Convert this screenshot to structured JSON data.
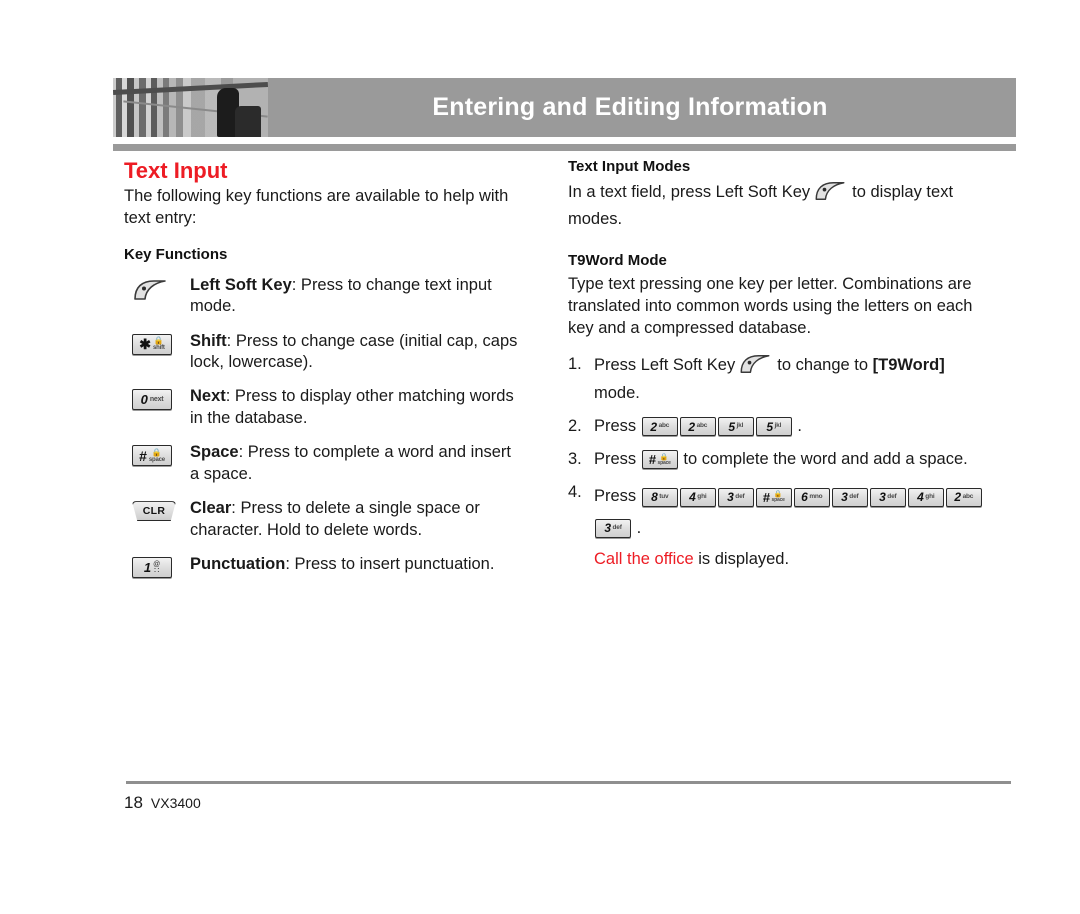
{
  "header": {
    "title": "Entering and Editing Information",
    "photo_alt": "grayscale-architecture-photo"
  },
  "left_column": {
    "section_title": "Text Input",
    "intro": "The following key functions are available to help with text entry:",
    "subheading": "Key Functions",
    "key_functions": [
      {
        "icon": "left-soft-key",
        "key_label": "",
        "key_sub": "",
        "term": "Left Soft Key",
        "description": ": Press to change text input mode."
      },
      {
        "icon": "star-shift-key",
        "key_label": "✳",
        "key_sub": "shift",
        "term": "Shift",
        "description": ": Press to change case (initial cap, caps lock, lowercase)."
      },
      {
        "icon": "zero-next-key",
        "key_label": "0",
        "key_sub": "next",
        "term": "Next",
        "description": ": Press to display other matching words in the database."
      },
      {
        "icon": "pound-space-key",
        "key_label": "#",
        "key_sub": "space",
        "term": "Space",
        "description": ": Press to complete a word and insert a space."
      },
      {
        "icon": "clear-key",
        "key_label": "CLR",
        "key_sub": "",
        "term": "Clear",
        "description": ": Press to delete a single space or character. Hold to delete words."
      },
      {
        "icon": "one-punctuation-key",
        "key_label": "1",
        "key_sub": "@",
        "term": "Punctuation",
        "description": ": Press to insert punctuation."
      }
    ]
  },
  "right_column": {
    "text_input_modes": {
      "heading": "Text Input Modes",
      "text_before_icon": "In a text field, press Left Soft Key",
      "text_after_icon": "to display text modes."
    },
    "t9word_mode": {
      "heading": "T9Word Mode",
      "paragraph": "Type text pressing one key per letter. Combinations are translated into common words using the letters on each key and a compressed database."
    },
    "steps": [
      {
        "num": "1.",
        "text_before_icon": "Press Left Soft Key",
        "text_after_icon": "to change to ",
        "bold_tail": "[T9Word]",
        "tail": " mode.",
        "keys": []
      },
      {
        "num": "2.",
        "text_before_keys": "Press",
        "keys": [
          {
            "big": "2",
            "sub": "abc"
          },
          {
            "big": "2",
            "sub": "abc"
          },
          {
            "big": "5",
            "sub": "jkl"
          },
          {
            "big": "5",
            "sub": "jkl"
          }
        ],
        "tail": "."
      },
      {
        "num": "3.",
        "text_before_keys": "Press",
        "keys": [
          {
            "big": "#",
            "sub": "space",
            "lock": true
          }
        ],
        "tail": "to complete the word and add a space."
      },
      {
        "num": "4.",
        "text_before_keys": "Press",
        "keys": [
          {
            "big": "8",
            "sub": "tuv"
          },
          {
            "big": "4",
            "sub": "ghi"
          },
          {
            "big": "3",
            "sub": "def"
          },
          {
            "big": "#",
            "sub": "space",
            "lock": true
          },
          {
            "big": "6",
            "sub": "mno"
          },
          {
            "big": "3",
            "sub": "def"
          },
          {
            "big": "3",
            "sub": "def"
          },
          {
            "big": "4",
            "sub": "ghi"
          },
          {
            "big": "2",
            "sub": "abc"
          }
        ],
        "keys_line2": [
          {
            "big": "3",
            "sub": "def"
          }
        ],
        "tail": ".",
        "result_red": "Call the office",
        "result_rest": " is displayed."
      }
    ]
  },
  "footer": {
    "page_number": "18",
    "model": "VX3400"
  },
  "colors": {
    "accent_red": "#ed1c24",
    "header_gray": "#9a9a9a",
    "rule_gray": "#8f8f8f",
    "text": "#1a1a1a"
  }
}
